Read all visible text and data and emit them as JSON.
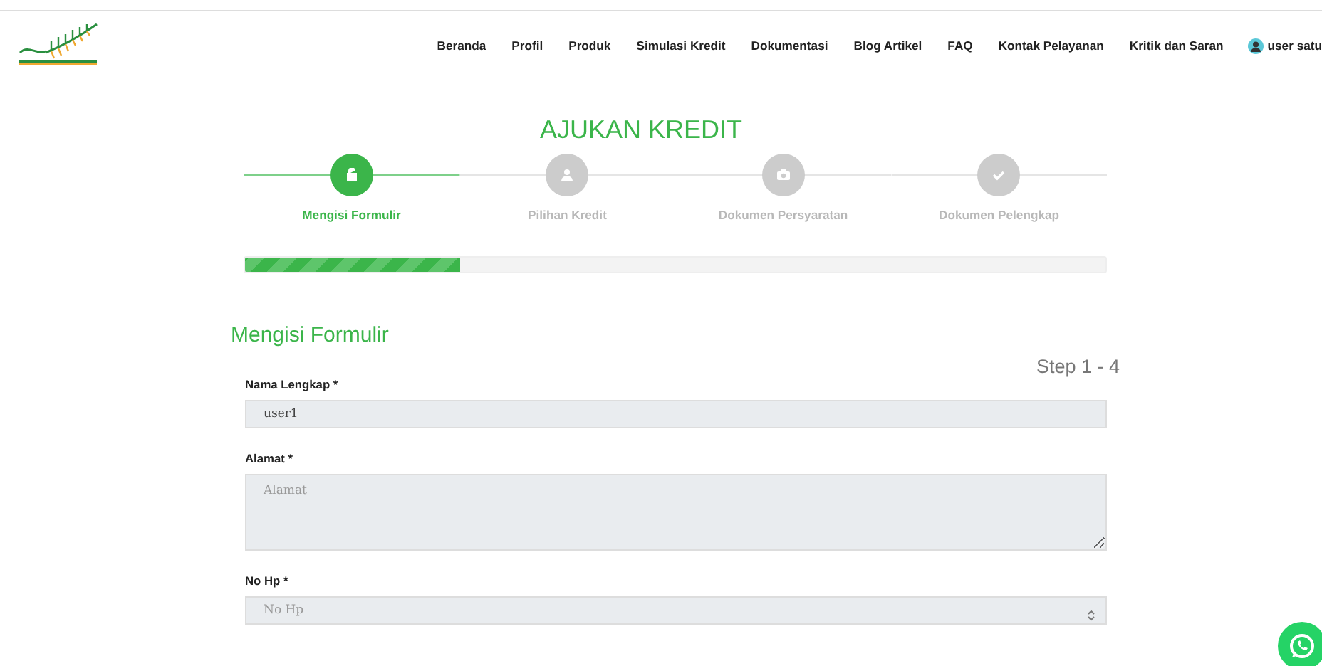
{
  "nav": {
    "items": [
      {
        "label": "Beranda"
      },
      {
        "label": "Profil"
      },
      {
        "label": "Produk"
      },
      {
        "label": "Simulasi Kredit"
      },
      {
        "label": "Dokumentasi"
      },
      {
        "label": "Blog Artikel"
      },
      {
        "label": "FAQ"
      },
      {
        "label": "Kontak Pelayanan"
      },
      {
        "label": "Kritik dan Saran"
      }
    ],
    "user": "user satu"
  },
  "title": "AJUKAN KREDIT",
  "steps": [
    {
      "label": "Mengisi Formulir",
      "selected": true
    },
    {
      "label": "Pilihan Kredit",
      "selected": false
    },
    {
      "label": "Dokumen Persyaratan",
      "selected": false
    },
    {
      "label": "Dokumen Pelengkap",
      "selected": false
    }
  ],
  "progress": {
    "level": 0.25
  },
  "section_title": "Mengisi Formulir",
  "step_counter": "Step 1 - 4",
  "fields": [
    {
      "kind": "text",
      "label": "Nama Lengkap *",
      "value": "user1"
    },
    {
      "kind": "textarea",
      "label": "Alamat *",
      "placeholder": "Alamat"
    },
    {
      "kind": "number",
      "label": "No Hp *",
      "placeholder": "No Hp"
    }
  ]
}
